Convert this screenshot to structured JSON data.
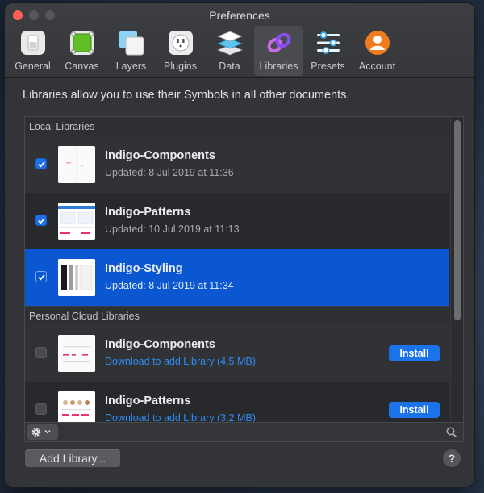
{
  "window": {
    "title": "Preferences"
  },
  "toolbar": {
    "items": [
      {
        "label": "General",
        "icon": "switch-icon"
      },
      {
        "label": "Canvas",
        "icon": "canvas-icon"
      },
      {
        "label": "Layers",
        "icon": "layers-icon"
      },
      {
        "label": "Plugins",
        "icon": "plug-icon"
      },
      {
        "label": "Data",
        "icon": "data-stack-icon"
      },
      {
        "label": "Libraries",
        "icon": "libraries-link-icon",
        "active": true
      },
      {
        "label": "Presets",
        "icon": "sliders-icon"
      },
      {
        "label": "Account",
        "icon": "account-icon"
      }
    ]
  },
  "intro": "Libraries allow you to use their Symbols in all other documents.",
  "local": {
    "heading": "Local Libraries",
    "items": [
      {
        "name": "Indigo-Components",
        "subtitle": "Updated: 8 Jul 2019 at 11:36",
        "checked": true
      },
      {
        "name": "Indigo-Patterns",
        "subtitle": "Updated: 10 Jul 2019 at 11:13",
        "checked": true
      },
      {
        "name": "Indigo-Styling",
        "subtitle": "Updated: 8 Jul 2019 at 11:34",
        "checked": true,
        "selected": true
      }
    ]
  },
  "cloud": {
    "heading": "Personal Cloud Libraries",
    "items": [
      {
        "name": "Indigo-Components",
        "subtitle": "Download to add Library (4,5 MB)",
        "checked": false,
        "action": "Install"
      },
      {
        "name": "Indigo-Patterns",
        "subtitle": "Download to add Library (3,2 MB)",
        "checked": false,
        "action": "Install"
      }
    ]
  },
  "footer": {
    "add_label": "Add Library...",
    "help_label": "?"
  },
  "colors": {
    "accent": "#1a73e8",
    "selection": "#0a57d1",
    "link": "#2e8cf0",
    "close": "#ff5f57"
  }
}
